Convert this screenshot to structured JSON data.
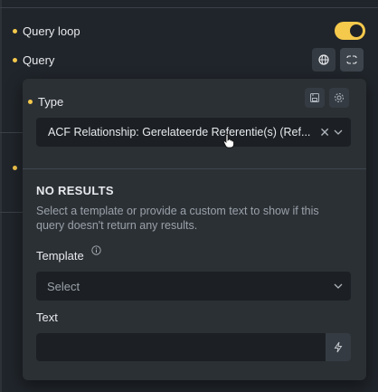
{
  "rows": {
    "query_loop": {
      "label": "Query loop",
      "toggle_on": true
    },
    "query": {
      "label": "Query"
    }
  },
  "panel": {
    "type": {
      "label": "Type",
      "selected": "ACF Relationship: Gerelateerde Referentie(s) (Ref..."
    },
    "no_results": {
      "heading": "NO RESULTS",
      "description_line1": "Select a template or provide a custom text to show if this",
      "description_line2": "query doesn't return any results."
    },
    "template": {
      "label": "Template",
      "placeholder": "Select"
    },
    "text": {
      "label": "Text",
      "value": ""
    }
  },
  "colors": {
    "accent": "#f5c94c",
    "background": "#20252b",
    "panel": "#2b3035",
    "input": "#1c2024"
  }
}
